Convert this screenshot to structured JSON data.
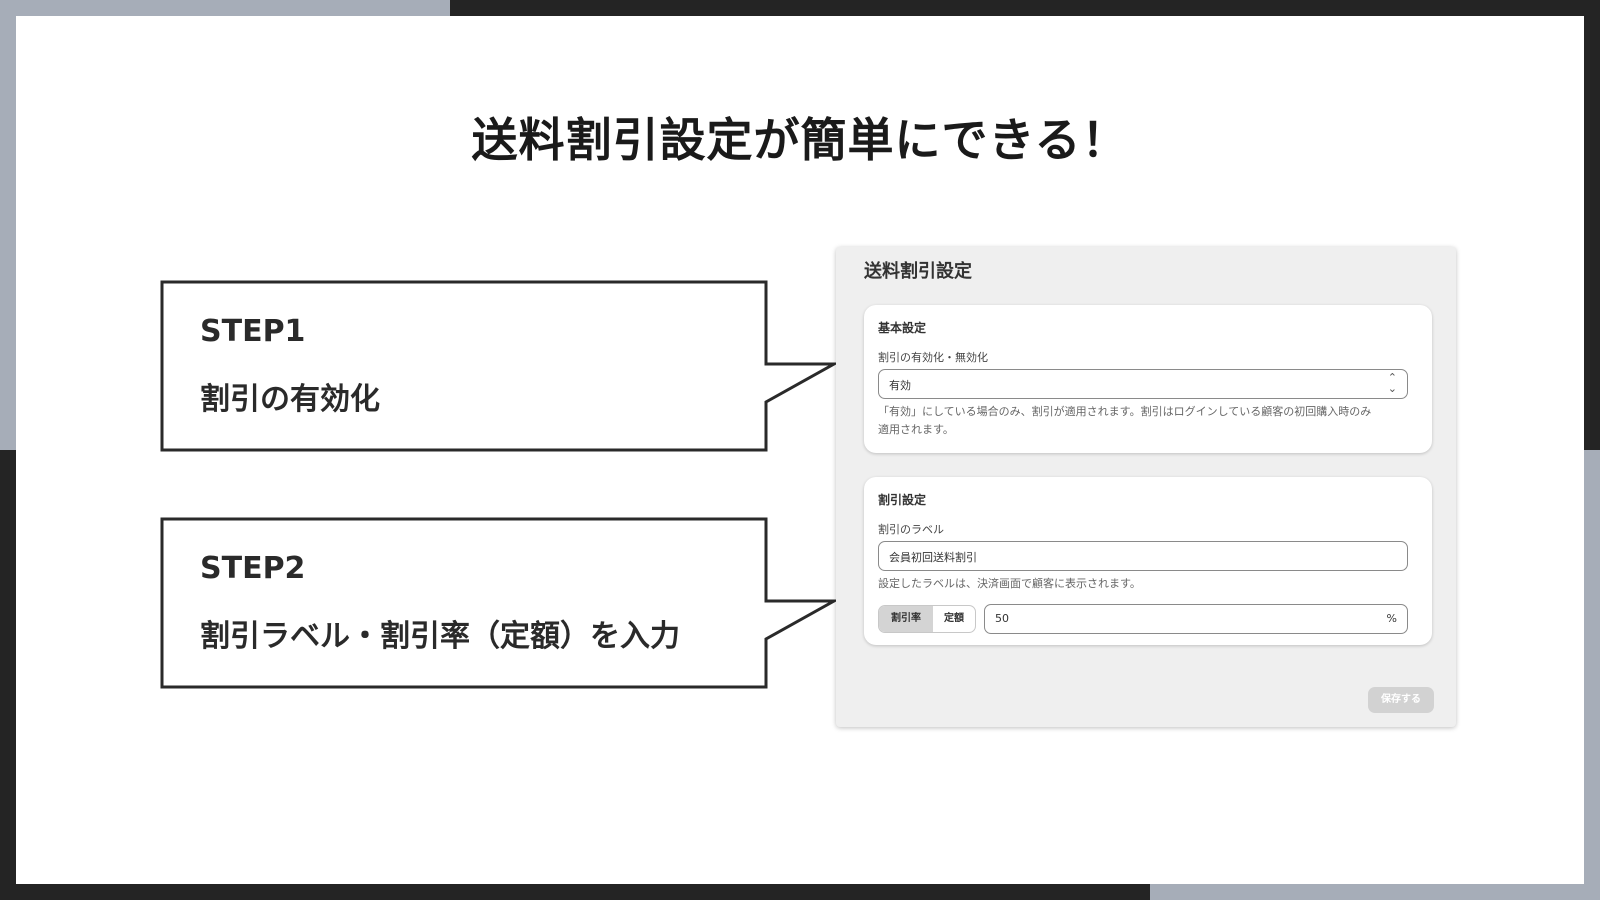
{
  "slide": {
    "title": "送料割引設定が簡単にできる！"
  },
  "callouts": [
    {
      "step": "STEP1",
      "description": "割引の有効化"
    },
    {
      "step": "STEP2",
      "description": "割引ラベル・割引率（定額）を入力"
    }
  ],
  "panel": {
    "title": "送料割引設定",
    "basic": {
      "section_title": "基本設定",
      "field_label": "割引の有効化・無効化",
      "select_value": "有効",
      "help_line1": "「有効」にしている場合のみ、割引が適用されます。割引はログインしている顧客の初回購入時のみ",
      "help_line2": "適用されます。"
    },
    "discount": {
      "section_title": "割引設定",
      "label_field_label": "割引のラベル",
      "label_value": "会員初回送料割引",
      "label_help": "設定したラベルは、決済画面で顧客に表示されます。",
      "segment_rate": "割引率",
      "segment_fixed": "定額",
      "rate_value": "50",
      "rate_suffix": "%"
    },
    "save_label": "保存する"
  },
  "colors": {
    "frame_dark": "#242424",
    "frame_grey": "#a6adb8",
    "panel_bg": "#efefef",
    "text_dark": "#2a2a2a"
  }
}
